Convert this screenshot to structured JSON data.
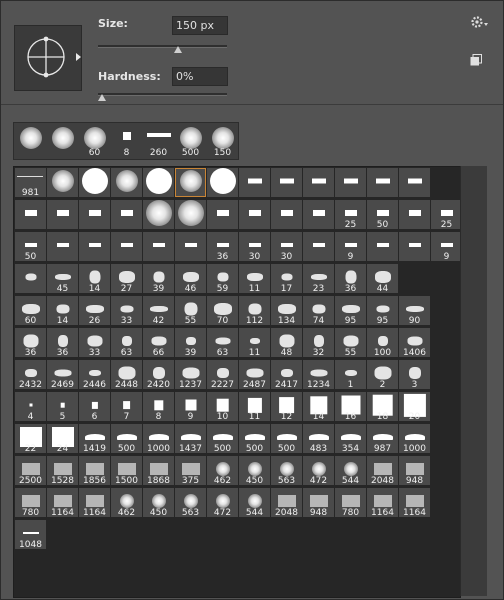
{
  "brush_options": {
    "size_label": "Size:",
    "size_value": "150 px",
    "size_fraction": 0.62,
    "hardness_label": "Hardness:",
    "hardness_value": "0%",
    "hardness_fraction": 0.0
  },
  "recent_brushes": [
    {
      "label": "",
      "kind": "soft"
    },
    {
      "label": "",
      "kind": "soft"
    },
    {
      "label": "60",
      "kind": "soft"
    },
    {
      "label": "8",
      "kind": "square"
    },
    {
      "label": "260",
      "kind": "text"
    },
    {
      "label": "500",
      "kind": "soft"
    },
    {
      "label": "150",
      "kind": "soft"
    }
  ],
  "preset_rows": [
    [
      "981",
      "",
      "",
      "",
      "",
      "",
      "",
      "",
      "",
      "",
      "",
      "",
      ""
    ],
    [
      "",
      "",
      "",
      "",
      "",
      "",
      "",
      "",
      "",
      "",
      "25",
      "50",
      "",
      "25"
    ],
    [
      "50",
      "",
      "",
      "",
      "",
      "",
      "36",
      "30",
      "30",
      "",
      "9",
      "",
      "",
      "9"
    ],
    [
      "",
      "45",
      "14",
      "27",
      "39",
      "46",
      "59",
      "11",
      "17",
      "23",
      "36",
      "44"
    ],
    [
      "60",
      "14",
      "26",
      "33",
      "42",
      "55",
      "70",
      "112",
      "134",
      "74",
      "95",
      "95",
      "90"
    ],
    [
      "36",
      "36",
      "33",
      "63",
      "66",
      "39",
      "63",
      "11",
      "48",
      "32",
      "55",
      "100",
      "1406"
    ],
    [
      "2432",
      "2469",
      "2446",
      "2448",
      "2420",
      "1237",
      "2227",
      "2487",
      "2417",
      "1234",
      "1",
      "2",
      "3"
    ],
    [
      "4",
      "5",
      "6",
      "7",
      "8",
      "9",
      "10",
      "11",
      "12",
      "14",
      "16",
      "18",
      "20"
    ],
    [
      "22",
      "24",
      "1419",
      "500",
      "1000",
      "1437",
      "500",
      "500",
      "500",
      "483",
      "354",
      "987",
      "1000"
    ],
    [
      "2500",
      "1528",
      "1856",
      "1500",
      "1868",
      "375",
      "462",
      "450",
      "563",
      "472",
      "544",
      "2048",
      "948"
    ],
    [
      "780",
      "1164",
      "1164",
      "462",
      "450",
      "563",
      "472",
      "544",
      "2048",
      "948",
      "780",
      "1164",
      "1164"
    ],
    [
      "1048"
    ]
  ]
}
